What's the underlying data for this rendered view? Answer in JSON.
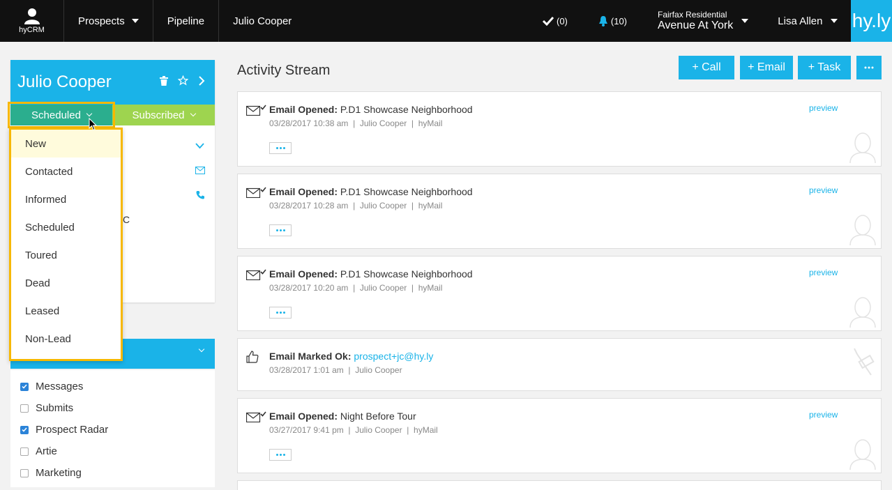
{
  "nav": {
    "brand_label": "hyCRM",
    "prospects": "Prospects",
    "pipeline": "Pipeline",
    "current": "Julio Cooper",
    "tasks_count": "(0)",
    "notifications_count": "(10)",
    "company": "Fairfax Residential",
    "community": "Avenue At York",
    "user": "Lisa Allen",
    "logo": "hy.ly"
  },
  "profile": {
    "name": "Julio Cooper",
    "status": "Scheduled",
    "subscription": "Subscribed",
    "partial_text": "C"
  },
  "status_options": [
    "New",
    "Contacted",
    "Informed",
    "Scheduled",
    "Toured",
    "Dead",
    "Leased",
    "Non-Lead"
  ],
  "filters": [
    {
      "label": "Messages",
      "checked": true
    },
    {
      "label": "Submits",
      "checked": false
    },
    {
      "label": "Prospect Radar",
      "checked": true
    },
    {
      "label": "Artie",
      "checked": false
    },
    {
      "label": "Marketing",
      "checked": false
    }
  ],
  "stream": {
    "title": "Activity Stream",
    "call_label": "+ Call",
    "email_label": "+ Email",
    "task_label": "+ Task",
    "preview_label": "preview",
    "items": [
      {
        "type": "Email Opened:",
        "subject": "P.D1 Showcase Neighborhood",
        "meta": "03/28/2017 10:38 am  |  Julio Cooper  |  hyMail"
      },
      {
        "type": "Email Opened:",
        "subject": "P.D1 Showcase Neighborhood",
        "meta": "03/28/2017 10:28 am  |  Julio Cooper  |  hyMail"
      },
      {
        "type": "Email Opened:",
        "subject": "P.D1 Showcase Neighborhood",
        "meta": "03/28/2017 10:20 am  |  Julio Cooper  |  hyMail"
      },
      {
        "type": "Email Marked Ok:",
        "subject": "prospect+jc@hy.ly",
        "meta": "03/28/2017 1:01 am  |  Julio Cooper"
      },
      {
        "type": "Email Opened:",
        "subject": "Night Before Tour",
        "meta": "03/27/2017 9:41 pm  |  Julio Cooper  |  hyMail"
      }
    ]
  },
  "colors": {
    "accent": "#1ab3e8",
    "status": "#2bae8e",
    "subscribed": "#9ed44f",
    "highlight": "#f7b800"
  }
}
